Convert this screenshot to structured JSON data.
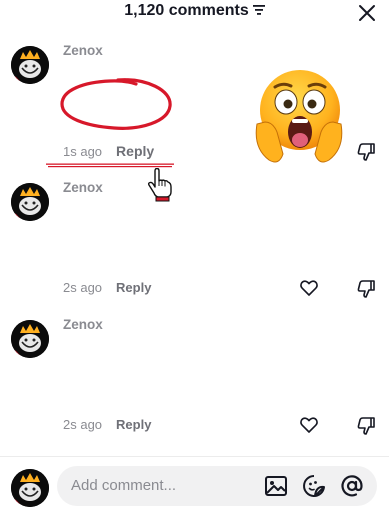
{
  "header": {
    "title": "1,120 comments"
  },
  "comments": [
    {
      "username": "Zenox",
      "time": "1s ago",
      "reply": "Reply"
    },
    {
      "username": "Zenox",
      "time": "2s ago",
      "reply": "Reply"
    },
    {
      "username": "Zenox",
      "time": "2s ago",
      "reply": "Reply"
    }
  ],
  "composer": {
    "placeholder": "Add comment..."
  },
  "colors": {
    "annotation_red": "#d7182a",
    "muted_text": "#8a8b91",
    "input_bg": "#f1f1f2"
  },
  "icons": [
    "filter-icon",
    "close-icon",
    "heart-icon",
    "dislike-icon",
    "image-icon",
    "sticker-icon",
    "mention-icon",
    "pointing-hand-icon",
    "shocked-face-emoji"
  ]
}
